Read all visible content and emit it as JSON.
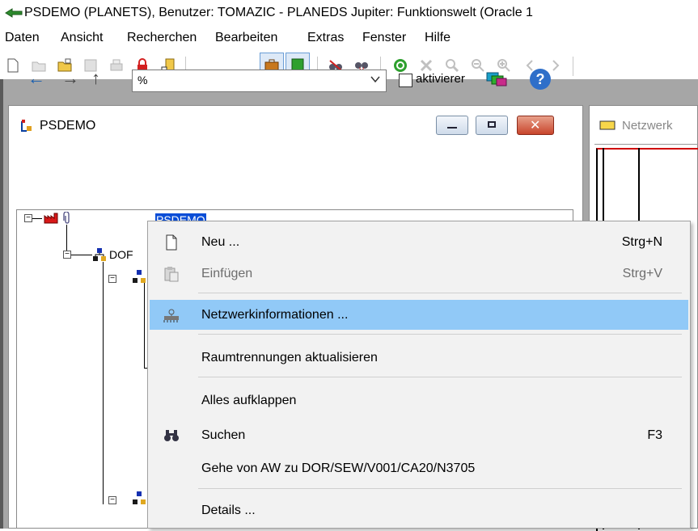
{
  "window": {
    "title": "PSDEMO  (PLANETS), Benutzer: TOMAZIC - PLANEDS Jupiter: Funktionswelt  (Oracle 1"
  },
  "menubar": {
    "items": [
      "Daten",
      "Ansicht",
      "Recherchen",
      "Bearbeiten",
      "Extras",
      "Fenster",
      "Hilfe"
    ]
  },
  "child_window": {
    "title": "PSDEMO",
    "filter_value": "%",
    "checkbox_label": "aktivierer",
    "checkbox_checked": false,
    "help_glyph": "?"
  },
  "tree": {
    "root_label": "PSDEMO",
    "child_label": "DOF"
  },
  "right_panel": {
    "title": "Netzwerk"
  },
  "context_menu": {
    "items": [
      {
        "label": "Neu ...",
        "shortcut": "Strg+N",
        "enabled": true
      },
      {
        "label": "Einfügen",
        "shortcut": "Strg+V",
        "enabled": false
      },
      {
        "label": "Netzwerkinformationen ...",
        "shortcut": "",
        "enabled": true,
        "highlighted": true
      },
      {
        "label": "Raumtrennungen aktualisieren",
        "shortcut": "",
        "enabled": true
      },
      {
        "label": "Alles aufklappen",
        "shortcut": "",
        "enabled": true
      },
      {
        "label": "Suchen",
        "shortcut": "F3",
        "enabled": true
      },
      {
        "label": "Gehe von AW zu DOR/SEW/V001/CA20/N3705",
        "shortcut": "",
        "enabled": true
      },
      {
        "label": "Details ...",
        "shortcut": "",
        "enabled": true
      }
    ]
  },
  "colors": {
    "selection": "#0a4dd6",
    "menu_highlight": "#91c9f7",
    "workspace": "#a6a6a6"
  }
}
